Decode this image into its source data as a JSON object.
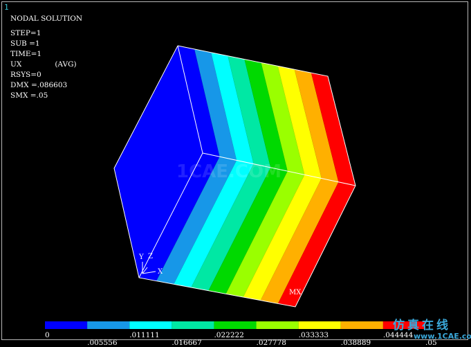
{
  "window_number": "1",
  "info": {
    "title": "NODAL SOLUTION",
    "step": "STEP=1",
    "sub": "SUB =1",
    "time": "TIME=1",
    "ux": "UX",
    "avg": "(AVG)",
    "rsys": "RSYS=0",
    "dmx": "DMX =.086603",
    "smx": "SMX =.05"
  },
  "triad": {
    "y": "Y",
    "z": "Z",
    "x": "X"
  },
  "max_marker": "MX",
  "watermark": "1CAE.COM",
  "logo": {
    "cn": "仿真在线",
    "url": "www.1CAE.com"
  },
  "contour": {
    "colors": [
      "#0000ff",
      "#1797e8",
      "#00ffff",
      "#00e8a4",
      "#00d900",
      "#9aff00",
      "#ffff00",
      "#ffb000",
      "#ff0000"
    ],
    "labels_top": [
      "0",
      ".011111",
      ".022222",
      ".033333",
      ".044444"
    ],
    "labels_bottom": [
      ".005556",
      ".016667",
      ".027778",
      ".038889",
      ".05"
    ]
  }
}
